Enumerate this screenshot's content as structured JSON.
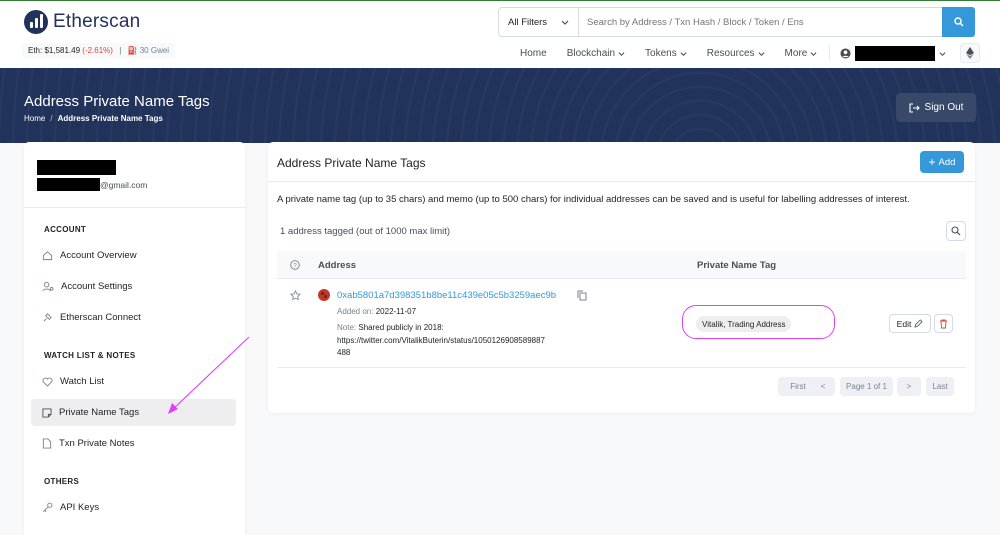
{
  "header": {
    "brand": "Etherscan",
    "eth_price_label": "Eth: $1,581.49",
    "eth_change": "(-2.61%)",
    "separator": "|",
    "gas": "30 Gwei",
    "search": {
      "filter": "All Filters",
      "placeholder": "Search by Address / Txn Hash / Block / Token / Ens"
    },
    "nav": [
      {
        "label": "Home"
      },
      {
        "label": "Blockchain"
      },
      {
        "label": "Tokens"
      },
      {
        "label": "Resources"
      },
      {
        "label": "More"
      }
    ]
  },
  "hero": {
    "title": "Address Private Name Tags",
    "breadcrumb": {
      "home": "Home",
      "sep": "/",
      "current": "Address Private Name Tags"
    },
    "signout_label": "Sign Out"
  },
  "sidebar": {
    "email_suffix": "@gmail.com",
    "sections": [
      {
        "heading": "ACCOUNT",
        "items": [
          "Account Overview",
          "Account Settings",
          "Etherscan Connect"
        ]
      },
      {
        "heading": "WATCH LIST & NOTES",
        "items": [
          "Watch List",
          "Private Name Tags",
          "Txn Private Notes"
        ]
      },
      {
        "heading": "OTHERS",
        "items": [
          "API Keys"
        ]
      }
    ]
  },
  "main": {
    "title": "Address Private Name Tags",
    "add_label": "Add",
    "description": "A private name tag (up to 35 chars) and memo (up to 500 chars) for individual addresses can be saved and is useful for labelling addresses of interest.",
    "count": "1 address tagged (out of 1000 max limit)",
    "table": {
      "columns": [
        "Address",
        "Private Name Tag"
      ],
      "rows": [
        {
          "address": "0xab5801a7d398351b8be11c439e05c5b3259aec9b",
          "added_label": "Added on:",
          "added_date": "2022-11-07",
          "note_label": "Note:",
          "note_line1": "Shared publicly in 2018:",
          "note_line2": "https://twitter.com/VitalikButerin/status/1050126908589887",
          "note_line3": "488",
          "tag": "Vitalik, Trading Address",
          "edit_label": "Edit"
        }
      ]
    },
    "pagination": {
      "first": "First",
      "prev": "<",
      "page": "Page 1 of 1",
      "next": ">",
      "last": "Last"
    }
  },
  "colors": {
    "brand_navy": "#21325b",
    "accent_blue": "#3498db",
    "negative_red": "#de4437",
    "highlight_magenta": "#e040fb"
  }
}
